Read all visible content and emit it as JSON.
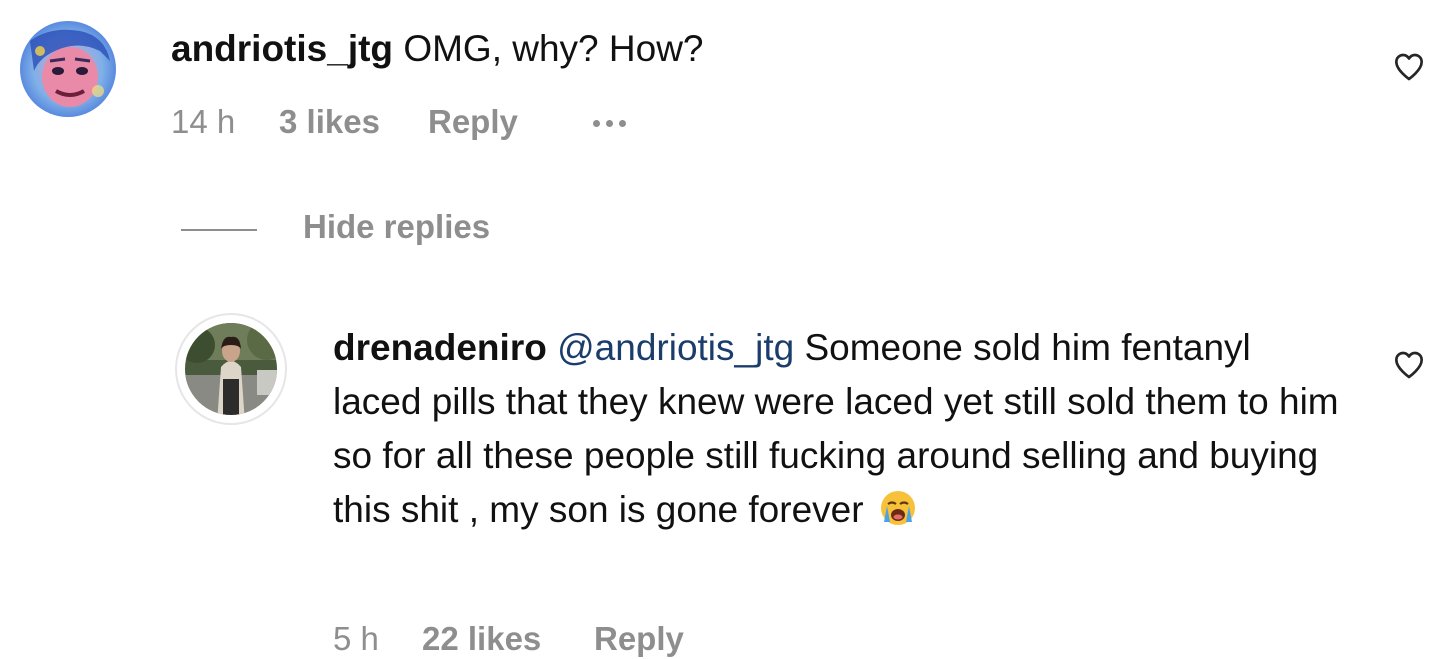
{
  "comments": [
    {
      "username": "andriotis_jtg",
      "text": "OMG, why? How?",
      "time": "14 h",
      "likes": "3 likes",
      "reply_label": "Reply",
      "has_more_menu": true,
      "avatar_icon": "avatar-photo-drawn-face"
    }
  ],
  "replies_toggle": {
    "label": "Hide replies"
  },
  "replies": [
    {
      "username": "drenadeniro",
      "mention": "@andriotis_jtg",
      "text": "Someone sold him fentanyl laced pills that they knew were laced yet still sold them to him so for all these people still fucking around selling and buying this shit , my son is gone forever",
      "emoji": "loudly-crying-face-emoji",
      "time": "5 h",
      "likes": "22 likes",
      "reply_label": "Reply",
      "avatar_icon": "avatar-photo-woman"
    }
  ],
  "colors": {
    "text": "#111111",
    "muted": "#8e8e8e",
    "mention": "#1b3d6b",
    "background": "#ffffff"
  }
}
